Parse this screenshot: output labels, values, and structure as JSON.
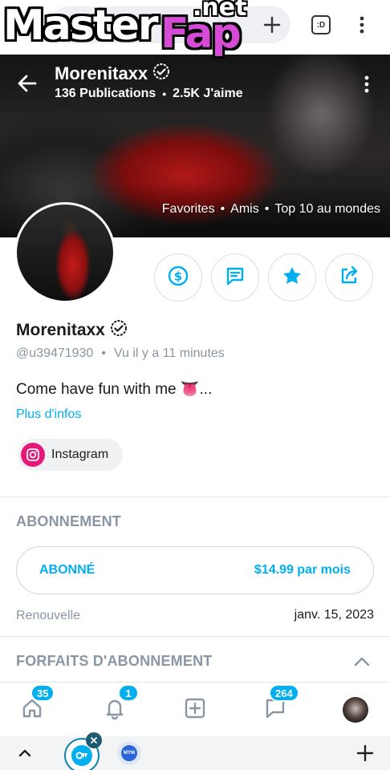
{
  "watermark": {
    "master": "Master",
    "fap": "Fap",
    "net": ".net"
  },
  "browser": {
    "icons": [
      "plus-icon",
      "tab-switcher-icon",
      "more-vertical-icon"
    ],
    "tab_switcher_label": ":D"
  },
  "cover": {
    "name": "Morenitaxx",
    "publications": "136 Publications",
    "likes": "2.5K J'aime",
    "links": [
      "Favorites",
      "Amis",
      "Top 10 au mondes"
    ]
  },
  "actions": [
    "dollar-tip-icon",
    "message-icon",
    "star-icon",
    "share-icon"
  ],
  "profile": {
    "name": "Morenitaxx",
    "handle": "@u39471930",
    "last_seen": "Vu il y a 11 minutes",
    "bio": "Come have fun with me 👅...",
    "more_info": "Plus d'infos",
    "instagram": "Instagram"
  },
  "subscription": {
    "section_title": "ABONNEMENT",
    "status": "ABONNÉ",
    "price": "$14.99 par mois",
    "renew_label": "Renouvelle",
    "renew_date": "janv. 15, 2023",
    "plans_title": "FORFAITS D'ABONNEMENT"
  },
  "nav": {
    "home_badge": "35",
    "notifications_badge": "1",
    "messages_badge": "264"
  },
  "browser_bottom": {
    "mym_label": "MYM"
  },
  "colors": {
    "accent": "#00aff0",
    "muted": "#8a96a3",
    "instagram": "#e6197a"
  }
}
